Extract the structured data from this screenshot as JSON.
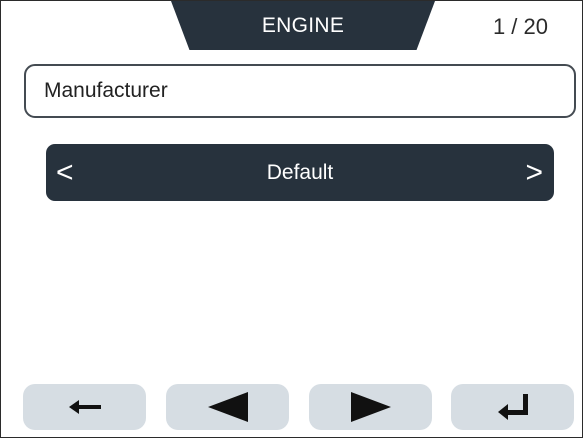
{
  "header": {
    "title": "ENGINE",
    "page_counter": "1 / 20"
  },
  "field": {
    "label": "Manufacturer"
  },
  "selector": {
    "value": "Default",
    "prev_glyph": "<",
    "next_glyph": ">"
  },
  "buttons": [
    {
      "icon": "arrow-left-icon"
    },
    {
      "icon": "triangle-left-icon"
    },
    {
      "icon": "triangle-right-icon"
    },
    {
      "icon": "enter-return-icon"
    }
  ],
  "colors": {
    "dark": "#27323d",
    "button_bg": "#d6dde3",
    "icon": "#111111"
  }
}
